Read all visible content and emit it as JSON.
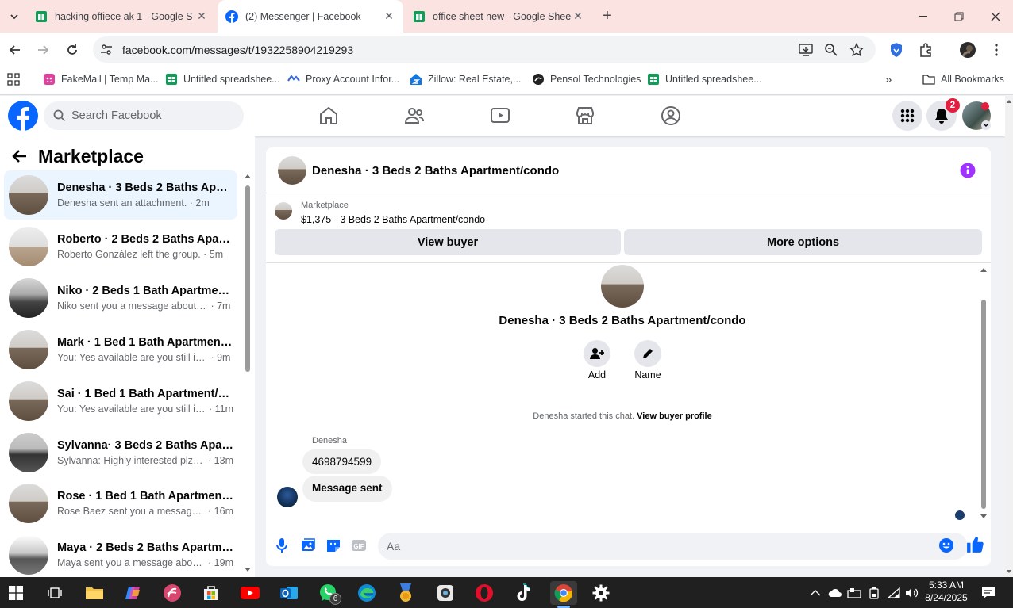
{
  "browser": {
    "tabs": [
      {
        "title": "hacking offiece ak 1 - Google S",
        "icon": "google-sheets-icon",
        "active": false
      },
      {
        "title": "(2) Messenger | Facebook",
        "icon": "facebook-icon",
        "active": true
      },
      {
        "title": "office sheet new - Google Shee",
        "icon": "google-sheets-icon",
        "active": false
      }
    ],
    "url": "facebook.com/messages/t/1932258904219293",
    "bookmarks": [
      {
        "label": "FakeMail | Temp Ma...",
        "icon": "fakemail-icon"
      },
      {
        "label": "Untitled spreadshee...",
        "icon": "google-sheets-icon"
      },
      {
        "label": "Proxy Account Infor...",
        "icon": "proxy-icon"
      },
      {
        "label": "Zillow: Real Estate,...",
        "icon": "zillow-icon"
      },
      {
        "label": "Pensol Technologies",
        "icon": "pensol-icon"
      },
      {
        "label": "Untitled spreadshee...",
        "icon": "google-sheets-icon"
      }
    ],
    "all_bookmarks": "All Bookmarks"
  },
  "facebook": {
    "search_placeholder": "Search Facebook",
    "notification_count": "2"
  },
  "sidebar": {
    "title": "Marketplace",
    "conversations": [
      {
        "name": "Denesha · 3 Beds 2 Baths Apart...",
        "preview": "Denesha sent an attachment.",
        "time": "2m",
        "selected": true
      },
      {
        "name": "Roberto · 2 Beds 2 Baths Apart...",
        "preview": "Roberto González left the group.",
        "time": "5m",
        "selected": false
      },
      {
        "name": "Niko · 2 Beds 1 Bath Apartment/...",
        "preview": "Niko sent you a message about yo...",
        "time": "7m",
        "selected": false
      },
      {
        "name": "Mark · 1 Bed 1 Bath Apartment/...",
        "preview": "You: Yes available are you still inter...",
        "time": "9m",
        "selected": false
      },
      {
        "name": "Sai · 1 Bed 1 Bath Apartment/co...",
        "preview": "You: Yes available are you still int...",
        "time": "11m",
        "selected": false
      },
      {
        "name": "Sylvanna· 3 Beds 2 Baths Apart...",
        "preview": "Sylvanna: Highly interested plz c...",
        "time": "13m",
        "selected": false
      },
      {
        "name": "Rose · 1 Bed 1 Bath Apartment/c...",
        "preview": "Rose Baez sent you a message a...",
        "time": "16m",
        "selected": false
      },
      {
        "name": "Maya · 2 Beds 2 Baths Apartme...",
        "preview": "Maya sent you a message about ...",
        "time": "19m",
        "selected": false
      }
    ]
  },
  "chat": {
    "title": "Denesha · 3 Beds 2 Baths Apartment/condo",
    "marketplace_label": "Marketplace",
    "listing": "$1,375 - 3 Beds 2 Baths Apartment/condo",
    "view_buyer": "View buyer",
    "more_options": "More options",
    "profile_name": "Denesha · 3 Beds 2 Baths Apartment/condo",
    "add_label": "Add",
    "name_label": "Name",
    "started_text": "Denesha started this chat.",
    "view_buyer_profile": "View buyer profile",
    "sender": "Denesha",
    "messages": [
      "4698794599",
      "Message sent"
    ],
    "composer_placeholder": "Aa"
  },
  "taskbar": {
    "whatsapp_badge": "6",
    "time": "5:33 AM",
    "date": "8/24/2025"
  },
  "colors": {
    "facebook_blue": "#0866ff",
    "messenger_purple": "#a033ff",
    "selected_row": "#ebf5ff",
    "notification_red": "#e41e3f"
  }
}
